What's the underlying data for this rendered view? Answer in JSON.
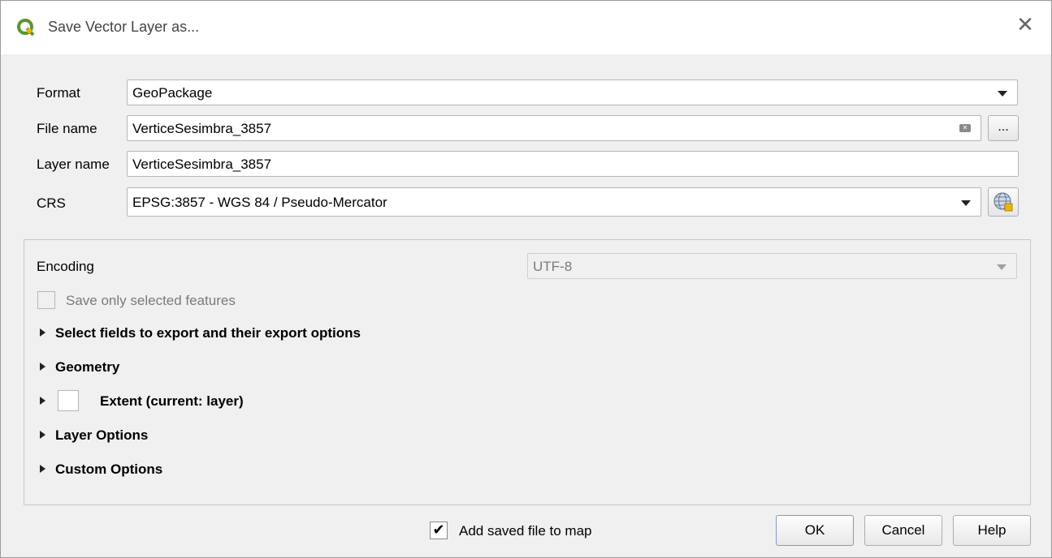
{
  "window": {
    "title": "Save Vector Layer as...",
    "close_label": "✕"
  },
  "form": {
    "format_label": "Format",
    "format_value": "GeoPackage",
    "filename_label": "File name",
    "filename_value": "VerticeSesimbra_3857",
    "browse_label": "...",
    "layername_label": "Layer name",
    "layername_value": "VerticeSesimbra_3857",
    "crs_label": "CRS",
    "crs_value": "EPSG:3857 - WGS 84 / Pseudo-Mercator"
  },
  "options": {
    "encoding_label": "Encoding",
    "encoding_value": "UTF-8",
    "save_selected_label": "Save only selected features",
    "sections": [
      "Select fields to export and their export options",
      "Geometry",
      "Extent (current: layer)",
      "Layer Options",
      "Custom Options"
    ]
  },
  "footer": {
    "add_to_map_label": "Add saved file to map",
    "add_to_map_checked": true,
    "ok_label": "OK",
    "cancel_label": "Cancel",
    "help_label": "Help"
  },
  "colors": {
    "qgis_green": "#589632",
    "qgis_yellow": "#f0b400",
    "focus_blue": "#7a9cc8"
  }
}
